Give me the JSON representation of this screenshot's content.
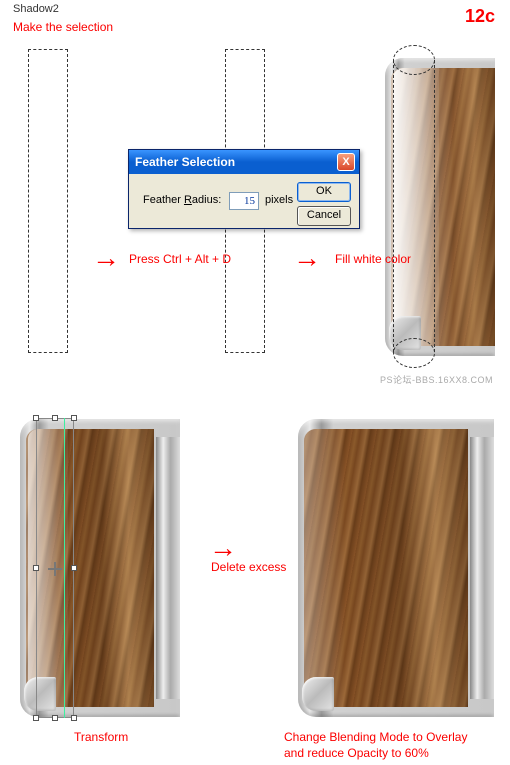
{
  "header": {
    "title": "Shadow2",
    "step_number": "12c"
  },
  "instructions": {
    "make_selection": "Make the selection",
    "shortcut": "Press Ctrl + Alt + D",
    "fill_white": "Fill white color",
    "transform": "Transform",
    "delete_excess": "Delete excess",
    "final": "Change Blending Mode to Overlay\nand reduce Opacity to 60%"
  },
  "dialog": {
    "title": "Feather Selection",
    "label_prefix": "Feather ",
    "label_underlined": "R",
    "label_suffix": "adius:",
    "value": "15",
    "unit": "pixels",
    "ok": "OK",
    "cancel": "Cancel",
    "close": "X"
  },
  "watermark": "PS论坛-BBS.16XX8.COM"
}
